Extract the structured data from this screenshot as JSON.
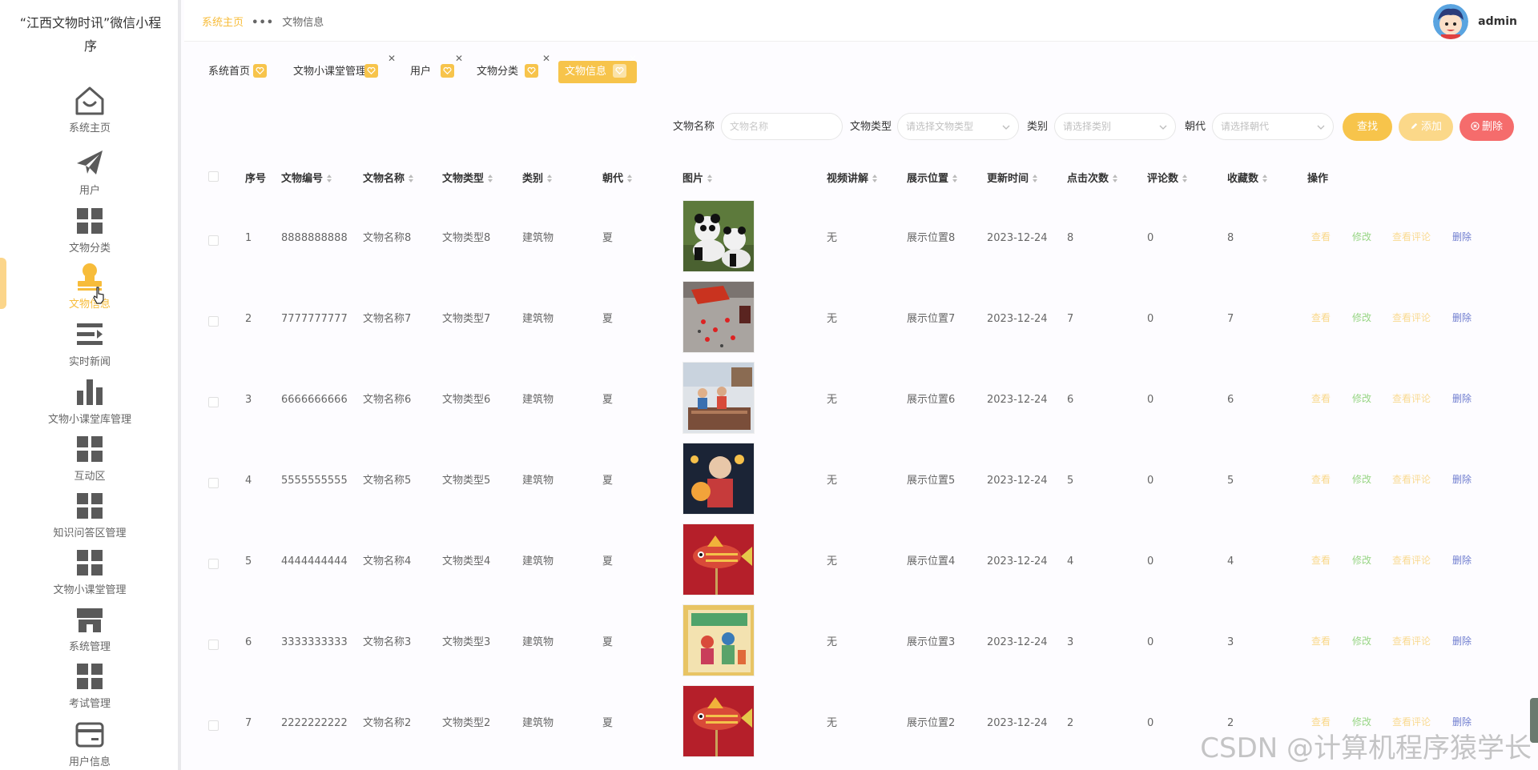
{
  "app": {
    "title": "“江西文物时讯”微信小程序"
  },
  "sidebar": {
    "items": [
      {
        "label": "系统主页",
        "icon": "home-icon"
      },
      {
        "label": "用户",
        "icon": "paper-plane-icon"
      },
      {
        "label": "文物分类",
        "icon": "grid-icon"
      },
      {
        "label": "文物信息",
        "icon": "stamp-icon"
      },
      {
        "label": "实时新闻",
        "icon": "list-icon"
      },
      {
        "label": "文物小课堂库管理",
        "icon": "bar-chart-icon"
      },
      {
        "label": "互动区",
        "icon": "grid-icon"
      },
      {
        "label": "知识问答区管理",
        "icon": "grid-icon"
      },
      {
        "label": "文物小课堂管理",
        "icon": "grid-icon"
      },
      {
        "label": "系统管理",
        "icon": "shop-icon"
      },
      {
        "label": "考试管理",
        "icon": "grid-icon"
      },
      {
        "label": "用户信息",
        "icon": "card-icon"
      }
    ],
    "active_index": 3
  },
  "header": {
    "breadcrumb": {
      "home": "系统主页",
      "separator": "•••",
      "current": "文物信息"
    },
    "user": {
      "name": "admin"
    }
  },
  "tabs": [
    {
      "label": "系统首页",
      "closable": false,
      "active": false
    },
    {
      "label": "文物小课堂管理",
      "closable": true,
      "active": false
    },
    {
      "label": "用户",
      "closable": true,
      "active": false
    },
    {
      "label": "文物分类",
      "closable": true,
      "active": false
    },
    {
      "label": "文物信息",
      "closable": true,
      "active": true
    }
  ],
  "search": {
    "name_label": "文物名称",
    "name_placeholder": "文物名称",
    "type_label": "文物类型",
    "type_placeholder": "请选择文物类型",
    "category_label": "类别",
    "category_placeholder": "请选择类别",
    "dynasty_label": "朝代",
    "dynasty_placeholder": "请选择朝代",
    "search_button": "查找",
    "add_button": "添加",
    "delete_button": "删除"
  },
  "table": {
    "columns": [
      "序号",
      "文物编号",
      "文物名称",
      "文物类型",
      "类别",
      "朝代",
      "图片",
      "视频讲解",
      "展示位置",
      "更新时间",
      "点击次数",
      "评论数",
      "收藏数",
      "操作"
    ],
    "actions": {
      "view": "查看",
      "edit": "修改",
      "comments": "查看评论",
      "delete": "删除"
    },
    "rows": [
      {
        "index": "1",
        "code": "8888888888",
        "name": "文物名称8",
        "type": "文物类型8",
        "category": "建筑物",
        "dynasty": "夏",
        "image": "panda",
        "video": "无",
        "location": "展示位置8",
        "updated": "2023-12-24",
        "clicks": "8",
        "comments": "0",
        "favorites": "8"
      },
      {
        "index": "2",
        "code": "7777777777",
        "name": "文物名称7",
        "type": "文物类型7",
        "category": "建筑物",
        "dynasty": "夏",
        "image": "red-table",
        "video": "无",
        "location": "展示位置7",
        "updated": "2023-12-24",
        "clicks": "7",
        "comments": "0",
        "favorites": "7"
      },
      {
        "index": "3",
        "code": "6666666666",
        "name": "文物名称6",
        "type": "文物类型6",
        "category": "建筑物",
        "dynasty": "夏",
        "image": "street",
        "video": "无",
        "location": "展示位置6",
        "updated": "2023-12-24",
        "clicks": "6",
        "comments": "0",
        "favorites": "6"
      },
      {
        "index": "4",
        "code": "5555555555",
        "name": "文物名称5",
        "type": "文物类型5",
        "category": "建筑物",
        "dynasty": "夏",
        "image": "lantern-girl",
        "video": "无",
        "location": "展示位置5",
        "updated": "2023-12-24",
        "clicks": "5",
        "comments": "0",
        "favorites": "5"
      },
      {
        "index": "5",
        "code": "4444444444",
        "name": "文物名称4",
        "type": "文物类型4",
        "category": "建筑物",
        "dynasty": "夏",
        "image": "fish-lantern",
        "video": "无",
        "location": "展示位置4",
        "updated": "2023-12-24",
        "clicks": "4",
        "comments": "0",
        "favorites": "4"
      },
      {
        "index": "6",
        "code": "3333333333",
        "name": "文物名称3",
        "type": "文物类型3",
        "category": "建筑物",
        "dynasty": "夏",
        "image": "new-year-print",
        "video": "无",
        "location": "展示位置3",
        "updated": "2023-12-24",
        "clicks": "3",
        "comments": "0",
        "favorites": "3"
      },
      {
        "index": "7",
        "code": "2222222222",
        "name": "文物名称2",
        "type": "文物类型2",
        "category": "建筑物",
        "dynasty": "夏",
        "image": "fish-lantern",
        "video": "无",
        "location": "展示位置2",
        "updated": "2023-12-24",
        "clicks": "2",
        "comments": "0",
        "favorites": "2"
      }
    ]
  },
  "watermark": "CSDN @计算机程序猿学长",
  "colors": {
    "accent": "#f7c44b",
    "danger": "#f56c6c",
    "success": "#76c95b",
    "link": "#6f7dcf",
    "icon": "#5a5a5a"
  }
}
